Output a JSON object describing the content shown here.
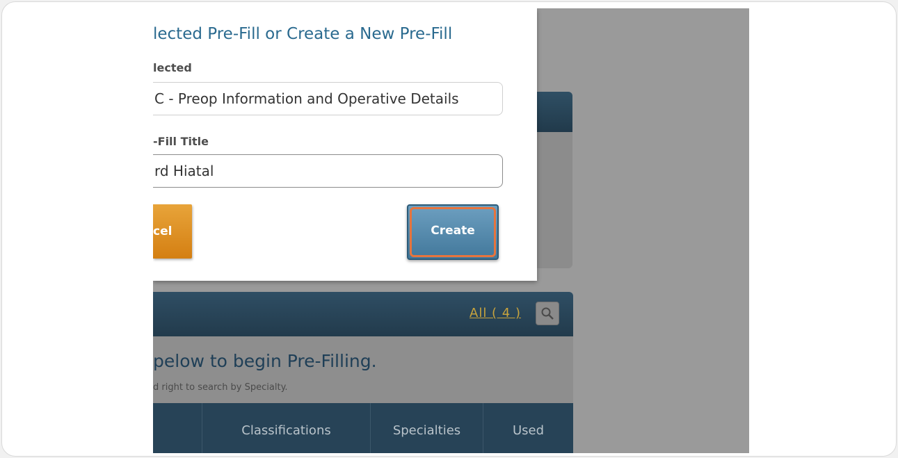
{
  "modal": {
    "title": "lected Pre-Fill or Create a New Pre-Fill",
    "selected_label": "lected",
    "selected_value": "C - Preop Information and Operative Details",
    "title_label": "-Fill Title",
    "title_value": "rd Hiatal",
    "cancel_label": "cel",
    "create_label": "Create"
  },
  "background": {
    "all_link": "All ( 4 )",
    "prompt": "pelow to begin Pre-Filling.",
    "subprompt": "d right to search by Specialty.",
    "columns": [
      "Classifications",
      "Specialties",
      "Used"
    ]
  },
  "icons": {
    "search": "search-icon"
  },
  "colors": {
    "accent": "#2a6a8f",
    "create_button": "#5b8db0",
    "cancel_button": "#df921f",
    "highlight_ring": "#e6743d",
    "link": "#c9a43d"
  }
}
